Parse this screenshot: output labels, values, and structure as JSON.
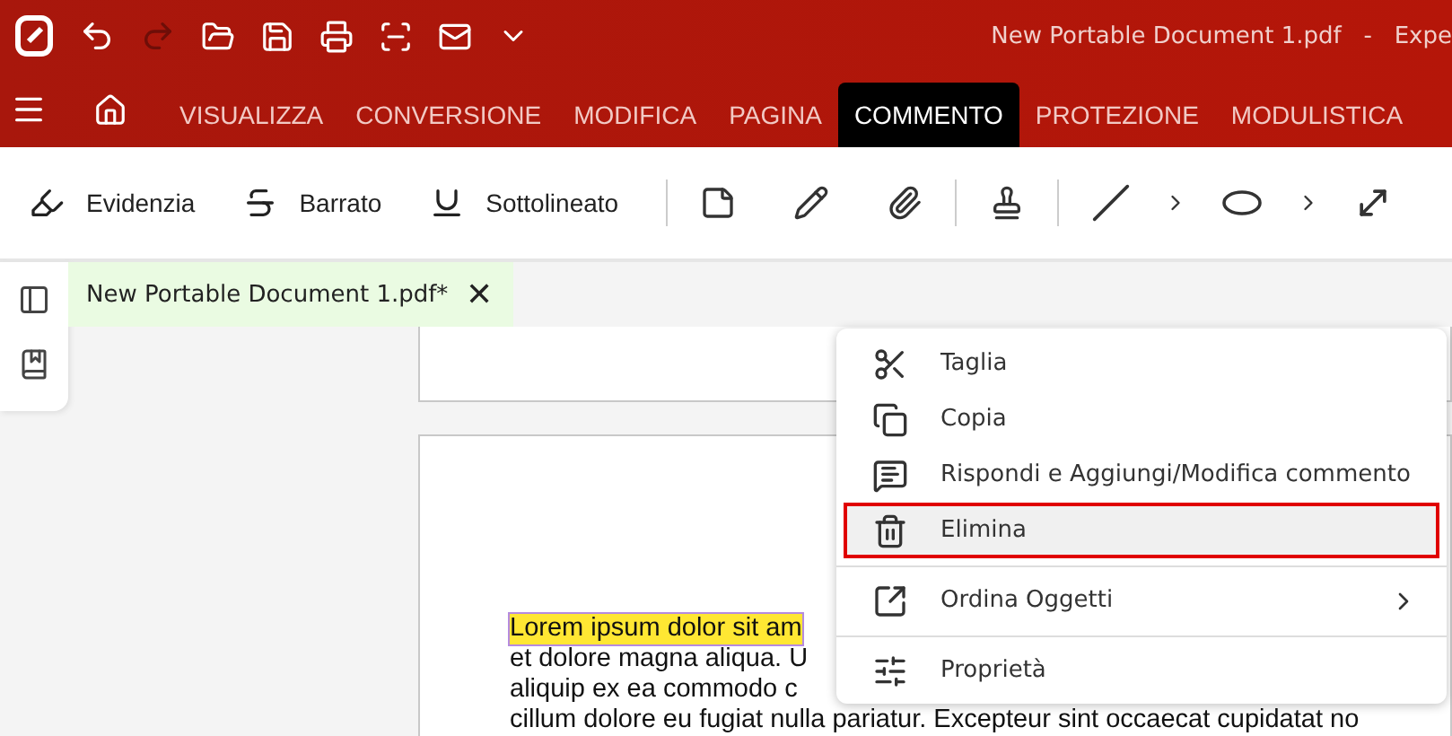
{
  "title_bar": {
    "title": "New Portable Document 1.pdf   -   Expe"
  },
  "ribbon_tabs": [
    {
      "label": "VISUALIZZA",
      "selected": false
    },
    {
      "label": "CONVERSIONE",
      "selected": false
    },
    {
      "label": "MODIFICA",
      "selected": false
    },
    {
      "label": "PAGINA",
      "selected": false
    },
    {
      "label": "COMMENTO",
      "selected": true
    },
    {
      "label": "PROTEZIONE",
      "selected": false
    },
    {
      "label": "MODULISTICA",
      "selected": false
    }
  ],
  "toolbar": {
    "text_tools": [
      {
        "kind": "highlight",
        "label": "Evidenzia"
      },
      {
        "kind": "strike",
        "label": "Barrato"
      },
      {
        "kind": "underline",
        "label": "Sottolineato"
      }
    ]
  },
  "document_tab": {
    "label": "New Portable Document 1.pdf*",
    "close": "✕"
  },
  "page_text": [
    {
      "text": "Lorem ipsum dolor sit am",
      "highlighted": true
    },
    {
      "text": "et dolore magna aliqua. U",
      "highlighted": false
    },
    {
      "text": "aliquip ex ea commodo c",
      "highlighted": false
    },
    {
      "text": "cillum dolore eu fugiat nulla pariatur. Excepteur sint occaecat cupidatat no",
      "highlighted": false
    }
  ],
  "context_menu": [
    {
      "kind": "cut",
      "label": "Taglia",
      "selected": false,
      "submenu": false
    },
    {
      "kind": "copy",
      "label": "Copia",
      "selected": false,
      "submenu": false
    },
    {
      "kind": "comment",
      "label": "Rispondi e Aggiungi/Modifica commento",
      "selected": false,
      "submenu": false
    },
    {
      "kind": "delete",
      "label": "Elimina",
      "selected": true,
      "submenu": false
    },
    {
      "kind": "divider"
    },
    {
      "kind": "arrange",
      "label": "Ordina Oggetti",
      "selected": false,
      "submenu": true
    },
    {
      "kind": "divider"
    },
    {
      "kind": "properties",
      "label": "Proprietà",
      "selected": false,
      "submenu": false
    }
  ]
}
